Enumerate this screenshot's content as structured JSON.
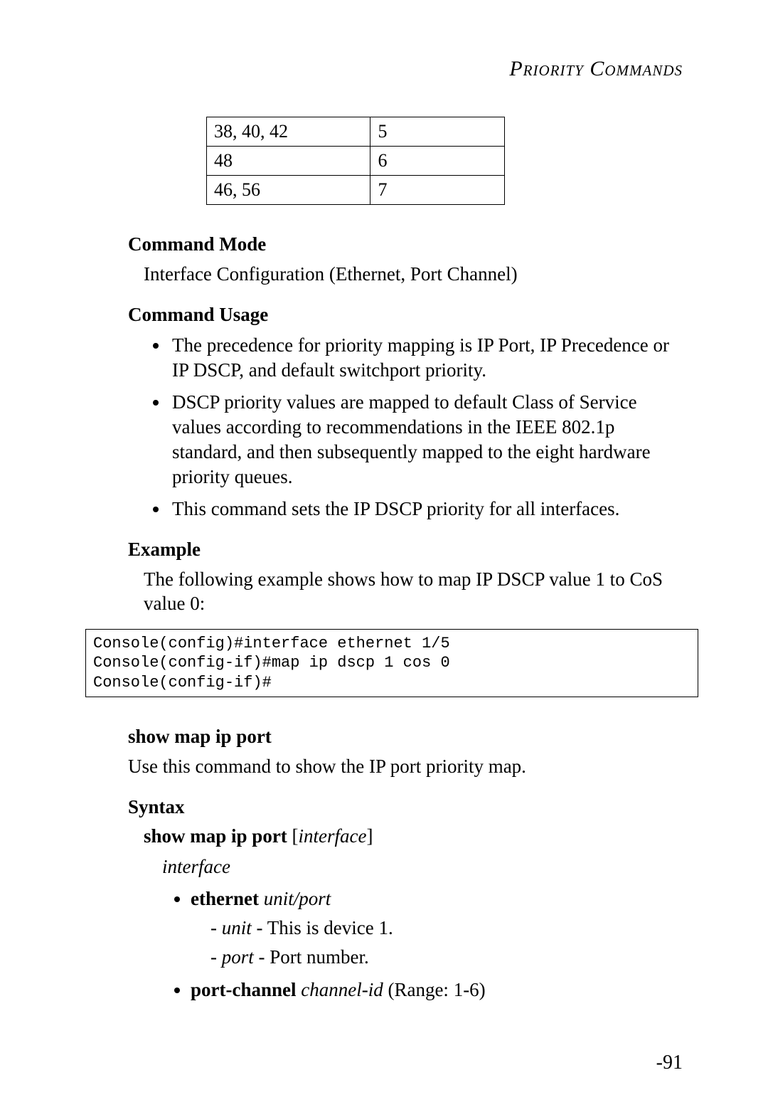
{
  "header": "Priority Commands",
  "table": {
    "rows": [
      {
        "c1": "38, 40, 42",
        "c2": "5"
      },
      {
        "c1": "48",
        "c2": "6"
      },
      {
        "c1": "46, 56",
        "c2": "7"
      }
    ]
  },
  "sections": {
    "cmd_mode": {
      "title": "Command Mode",
      "text": "Interface Configuration (Ethernet, Port Channel)"
    },
    "cmd_usage": {
      "title": "Command Usage",
      "bullets": [
        "The precedence for priority mapping is IP Port, IP Precedence or IP DSCP, and default switchport priority.",
        "DSCP priority values are mapped to default Class of Service values according to recommendations in the IEEE 802.1p standard, and then subsequently mapped to the eight hardware priority queues.",
        "This command sets the IP DSCP priority for all interfaces."
      ]
    },
    "example": {
      "title": "Example",
      "intro": "The following example shows how to map IP DSCP value 1 to CoS value 0:",
      "code": "Console(config)#interface ethernet 1/5\nConsole(config-if)#map ip dscp 1 cos 0\nConsole(config-if)#"
    },
    "show_cmd": {
      "title": "show map ip port",
      "desc": "Use this command to show the IP port priority map.",
      "syntax_title": "Syntax",
      "syntax_bold": "show map ip port",
      "syntax_rest_open": "[",
      "syntax_param": "interface",
      "syntax_rest_close": "]",
      "param_label": "interface",
      "eth_bold": "ethernet",
      "eth_ital": "unit/port",
      "unit_label": "unit",
      "unit_desc": " - This is device 1.",
      "port_label": "port",
      "port_desc": " - Port number.",
      "pc_bold": "port-channel",
      "pc_ital": "channel-id",
      "pc_rest": " (Range: 1-6)"
    }
  },
  "page_number": "-91"
}
